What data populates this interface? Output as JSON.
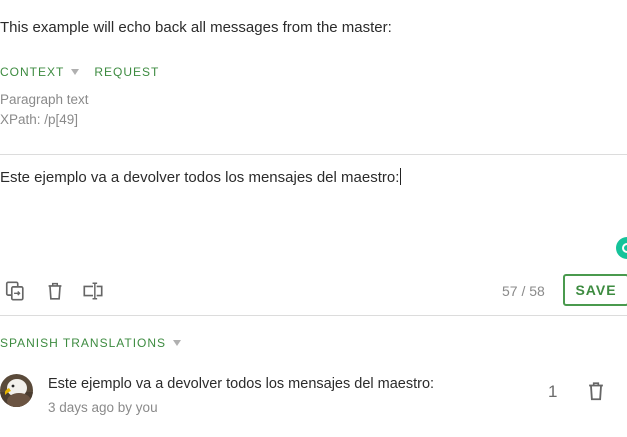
{
  "source": {
    "text": "This example will echo back all messages from the master:"
  },
  "context": {
    "tabs": [
      {
        "label": "CONTEXT"
      },
      {
        "label": "REQUEST"
      }
    ],
    "type": "Paragraph text",
    "xpath": "XPath: /p[49]"
  },
  "editor": {
    "value": "Este ejemplo va a devolver todos los mensajes del maestro:",
    "char_count": "57 / 58",
    "save_label": "SAVE"
  },
  "toolbar": {
    "icons": [
      "copy-source-icon",
      "delete-icon",
      "text-cursor-icon"
    ]
  },
  "translations": {
    "header": "SPANISH TRANSLATIONS",
    "items": [
      {
        "text": "Este ejemplo va a devolver todos los mensajes del maestro:",
        "meta": "3 days ago by you",
        "votes": "1"
      }
    ]
  },
  "colors": {
    "accent": "#3d8b40",
    "grammar": "#15c39a",
    "muted": "#8a8a8a"
  }
}
